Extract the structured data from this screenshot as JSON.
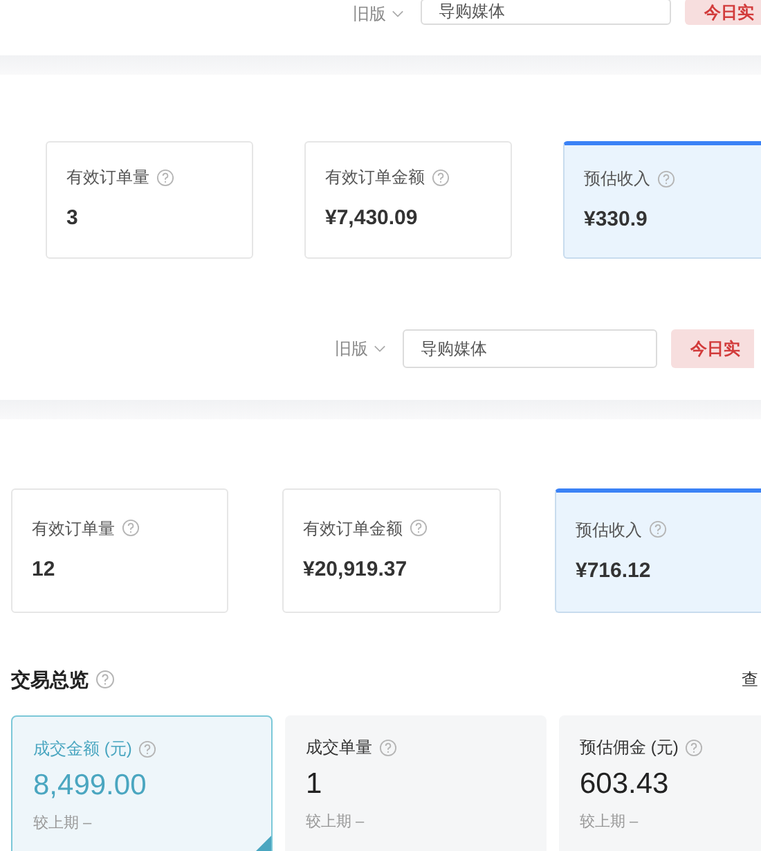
{
  "sections": [
    {
      "toolbar": {
        "version_label": "旧版",
        "search_value": "导购媒体",
        "button": "今日实"
      },
      "cards": [
        {
          "label": "有效订单量",
          "value": "3",
          "selected": false
        },
        {
          "label": "有效订单金额",
          "value": "¥7,430.09",
          "selected": false
        },
        {
          "label": "预估收入",
          "value": "¥330.9",
          "selected": true
        }
      ]
    },
    {
      "toolbar": {
        "version_label": "旧版",
        "search_value": "导购媒体",
        "button": "今日实"
      },
      "cards": [
        {
          "label": "有效订单量",
          "value": "12",
          "selected": false
        },
        {
          "label": "有效订单金额",
          "value": "¥20,919.37",
          "selected": false
        },
        {
          "label": "预估收入",
          "value": "¥716.12",
          "selected": true
        }
      ]
    }
  ],
  "overview": {
    "title": "交易总览",
    "link": "查",
    "cards": [
      {
        "label": "成交金额",
        "unit": "(元)",
        "value": "8,499.00",
        "compare": "较上期 –",
        "selected": true
      },
      {
        "label": "成交单量",
        "value": "1",
        "compare": "较上期 –",
        "selected": false
      },
      {
        "label": "预估佣金",
        "unit": "(元)",
        "value": "603.43",
        "compare": "较上期 –",
        "selected": false
      }
    ]
  }
}
